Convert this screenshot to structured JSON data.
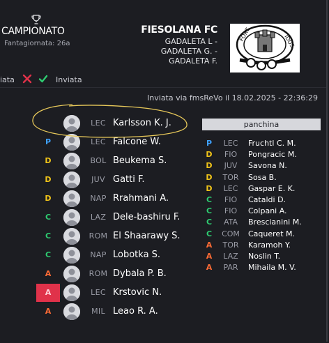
{
  "header": {
    "competition_title": "CAMPIONATO",
    "matchday_label": "Fantagiornata: 26a",
    "team_name": "FIESOLANA FC",
    "owners": [
      "GADALETA L -",
      "GADALETA G. -",
      "GADALETA F."
    ]
  },
  "status": {
    "partial_label": "iata",
    "sent_label": "Inviata",
    "sent_info": "Inviata via fmsReVo il 18.02.2025 - 22:36:29"
  },
  "lineup": [
    {
      "role": "",
      "team": "LEC",
      "name": "Karlsson K. J."
    },
    {
      "role": "P",
      "team": "LEC",
      "name": "Falcone W."
    },
    {
      "role": "D",
      "team": "BOL",
      "name": "Beukema S."
    },
    {
      "role": "D",
      "team": "JUV",
      "name": "Gatti F."
    },
    {
      "role": "D",
      "team": "NAP",
      "name": "Rrahmani A."
    },
    {
      "role": "C",
      "team": "LAZ",
      "name": "Dele-bashiru F."
    },
    {
      "role": "C",
      "team": "ROM",
      "name": "El Shaarawy S."
    },
    {
      "role": "C",
      "team": "NAP",
      "name": "Lobotka S."
    },
    {
      "role": "A",
      "team": "ROM",
      "name": "Dybala P. B."
    },
    {
      "role": "A",
      "team": "LEC",
      "name": "Krstovic N."
    },
    {
      "role": "A",
      "team": "MIL",
      "name": "Leao R. A."
    }
  ],
  "bench": {
    "title": "panchina",
    "players": [
      {
        "role": "P",
        "team": "LEC",
        "name": "Fruchtl C. M."
      },
      {
        "role": "D",
        "team": "FIO",
        "name": "Pongracic M."
      },
      {
        "role": "D",
        "team": "JUV",
        "name": "Savona N."
      },
      {
        "role": "D",
        "team": "TOR",
        "name": "Sosa B."
      },
      {
        "role": "D",
        "team": "LEC",
        "name": "Gaspar E. K."
      },
      {
        "role": "C",
        "team": "FIO",
        "name": "Cataldi D."
      },
      {
        "role": "C",
        "team": "FIO",
        "name": "Colpani A."
      },
      {
        "role": "C",
        "team": "ATA",
        "name": "Brescianini M."
      },
      {
        "role": "C",
        "team": "COM",
        "name": "Caqueret M."
      },
      {
        "role": "A",
        "team": "TOR",
        "name": "Karamoh Y."
      },
      {
        "role": "A",
        "team": "LAZ",
        "name": "Noslin T."
      },
      {
        "role": "A",
        "team": "PAR",
        "name": "Mihaila M. V."
      }
    ]
  },
  "colors": {
    "background": "#1c1d22",
    "role_P": "#3ea1ff",
    "role_D": "#f0c419",
    "role_C": "#2ecc71",
    "role_A": "#ff6b35",
    "highlight": "#e0324a",
    "annotation": "#e8c95a",
    "reject": "#e0324a",
    "confirm": "#2ecc71"
  },
  "icons": {
    "trophy": "trophy-icon",
    "reject": "close-icon",
    "confirm": "check-icon",
    "avatar": "user-avatar-icon"
  }
}
